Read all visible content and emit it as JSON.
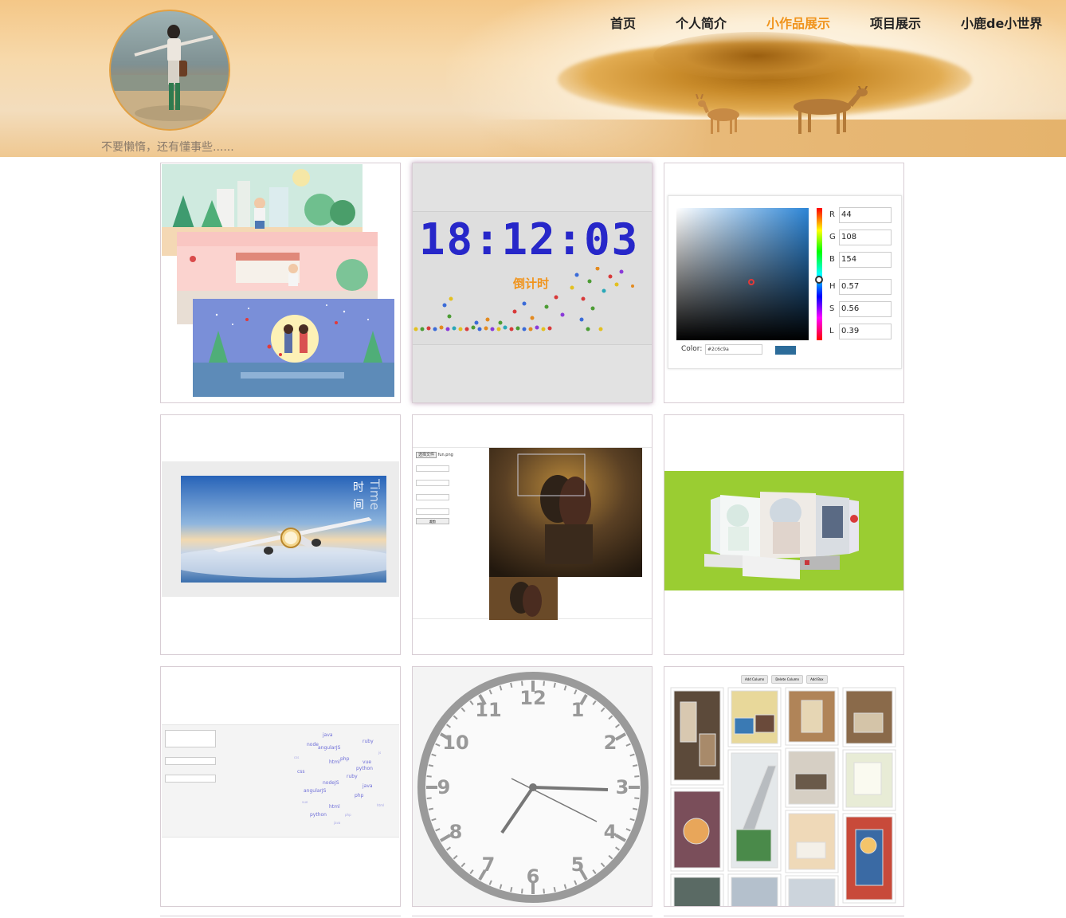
{
  "header": {
    "motto": "不要懒惰，还有懂事些......",
    "nav": [
      {
        "label": "首页",
        "active": false
      },
      {
        "label": "个人简介",
        "active": false
      },
      {
        "label": "小作品展示",
        "active": true
      },
      {
        "label": "项目展示",
        "active": false
      },
      {
        "label": "小鹿de小世界",
        "active": false
      }
    ],
    "accent_color": "#f0941d"
  },
  "gallery": {
    "clock_digits": "18:12:03",
    "countdown_label": "倒计时",
    "color_picker": {
      "r_label": "R",
      "r_value": "44",
      "g_label": "G",
      "g_value": "108",
      "b_label": "B",
      "b_value": "154",
      "h_label": "H",
      "h_value": "0.57",
      "s_label": "S",
      "s_value": "0.56",
      "l_label": "L",
      "l_value": "0.39",
      "color_label": "Color:",
      "color_hex": "#2c6c9a"
    },
    "time_card": {
      "title_cn_1": "时",
      "title_cn_2": "间",
      "title_en": "Time"
    },
    "crop_tool": {
      "choose_file": "选择文件",
      "file_name": "fun.png",
      "submit": "裁剪"
    },
    "tag_cloud": {
      "words": [
        "java",
        "node",
        "angularJS",
        "ruby",
        "html",
        "python",
        "php",
        "vue",
        "css",
        "nodeJS",
        "ruby",
        "java",
        "angularJS",
        "php",
        "html",
        "python"
      ]
    },
    "analog_clock": {
      "numbers": [
        "12",
        "1",
        "2",
        "3",
        "4",
        "5",
        "6",
        "7",
        "8",
        "9",
        "10",
        "11"
      ]
    },
    "layout_tool": {
      "buttons": [
        "Add Column",
        "Delete Column",
        "Add Box"
      ]
    }
  }
}
